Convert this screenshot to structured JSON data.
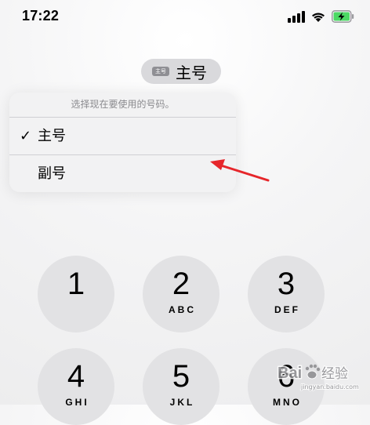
{
  "status_bar": {
    "time": "17:22",
    "icons": [
      "cellular-signal-icon",
      "wifi-icon",
      "battery-charging-icon"
    ],
    "battery_color": "#4cd964"
  },
  "line_selector": {
    "badge": "主号",
    "label": "主号"
  },
  "menu": {
    "title": "选择现在要使用的号码。",
    "items": [
      {
        "label": "主号",
        "selected": true,
        "check": "✓"
      },
      {
        "label": "副号",
        "selected": false
      }
    ]
  },
  "annotation": {
    "icon": "red-arrow-icon",
    "color": "#e6262b"
  },
  "keypad": [
    {
      "digit": "1",
      "letters": ""
    },
    {
      "digit": "2",
      "letters": "ABC"
    },
    {
      "digit": "3",
      "letters": "DEF"
    },
    {
      "digit": "4",
      "letters": "GHI"
    },
    {
      "digit": "5",
      "letters": "JKL"
    },
    {
      "digit": "6",
      "letters": "MNO"
    }
  ],
  "watermark": {
    "brand": "Bai",
    "icon": "paw-icon",
    "text": "经验",
    "sub": "jingyan.baidu.com"
  }
}
